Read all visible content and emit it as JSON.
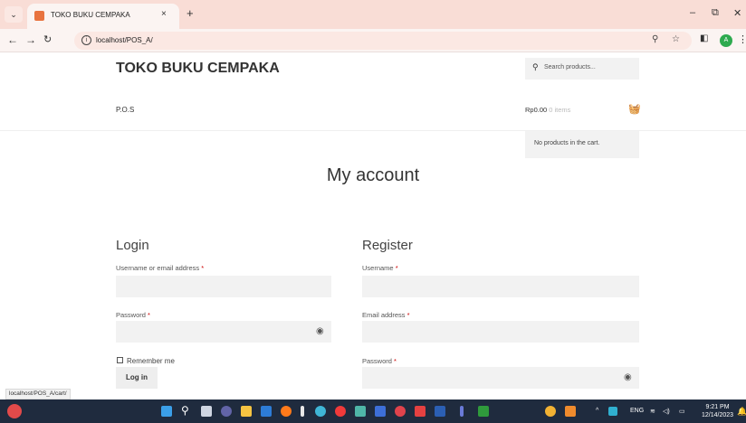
{
  "browser": {
    "tab_title": "TOKO BUKU CEMPAKA",
    "tab_close": "×",
    "new_tab": "+",
    "tab_list": "⌄",
    "url": "localhost/POS_A/",
    "profile_initial": "A",
    "controls": {
      "minimize": "–",
      "restore": "⧉",
      "close": "✕"
    },
    "status_url": "localhost/POS_A/cart/"
  },
  "site": {
    "title": "TOKO BUKU CEMPAKA",
    "search_placeholder": "Search products...",
    "nav_item": "P.O.S",
    "cart_total": "Rp0.00",
    "cart_items": "0 items",
    "cart_empty": "No products in the cart."
  },
  "account": {
    "page_title": "My account",
    "login": {
      "title": "Login",
      "username_label": "Username or email address",
      "password_label": "Password",
      "remember_label": "Remember me",
      "button": "Log in"
    },
    "register": {
      "title": "Register",
      "username_label": "Username",
      "email_label": "Email address",
      "password_label": "Password"
    },
    "required_mark": "*"
  },
  "taskbar": {
    "language": "ENG",
    "time": "9:21 PM",
    "date": "12/14/2023"
  },
  "colors": {
    "tabbar": "#f9ddd6",
    "taskbar": "#1f2b3e",
    "field": "#f2f2f2"
  }
}
